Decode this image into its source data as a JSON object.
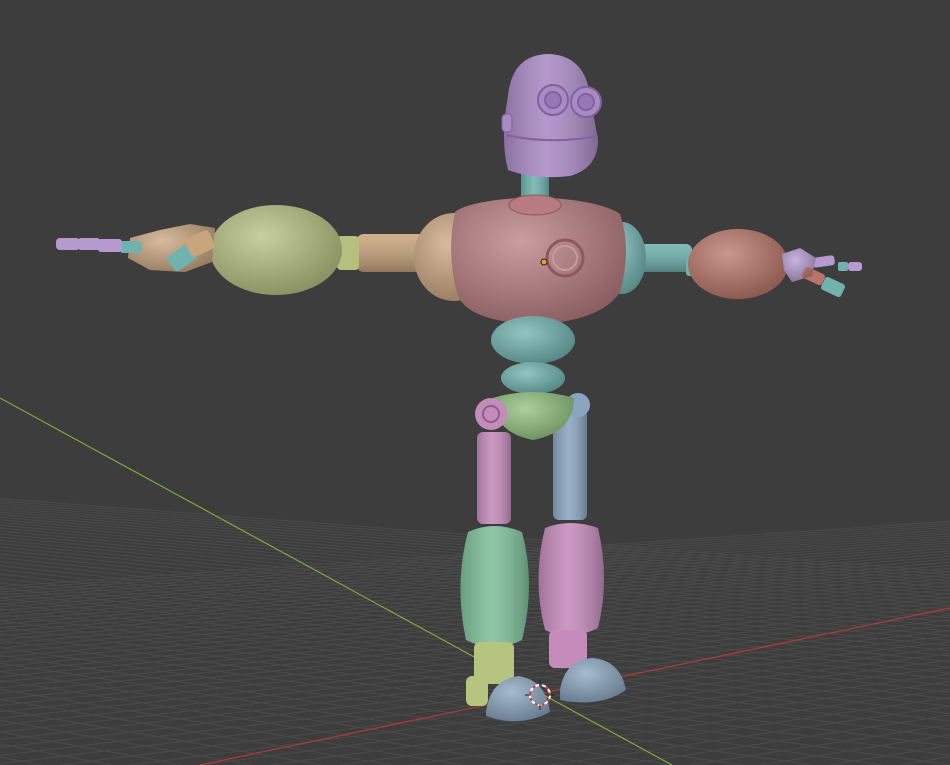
{
  "viewport": {
    "background_color": "#3d3d3d",
    "grid_color": "#4a4a4a",
    "x_axis_color": "#b33a3a",
    "y_axis_color": "#7fa83a"
  },
  "scene": {
    "object": "robot-character",
    "shading": "solid",
    "part_colors": {
      "head": "#a98ac4",
      "neck": "#6fb2ae",
      "torso": "#b87c80",
      "left_shoulder": "#c9a57e",
      "left_upper_arm": "#c9a57e",
      "left_forearm": "#b5bf7e",
      "left_hand": "#c9a57e",
      "right_shoulder": "#6fb2ae",
      "right_forearm": "#b87468",
      "right_hand": "#b59ad0",
      "waist": "#6fb2ae",
      "pelvis": "#8fc07c",
      "left_thigh": "#c48bbb",
      "right_thigh": "#8aa5bf",
      "left_shin": "#7fbf9a",
      "right_shin": "#c48bbb",
      "left_foot": "#8aa5bf",
      "right_foot": "#8aa5bf",
      "left_ankle": "#b5c47e",
      "right_ankle": "#c48bbb"
    },
    "origin_marker_color": "#f0a020",
    "cursor_icon": "3d-cursor-icon"
  }
}
